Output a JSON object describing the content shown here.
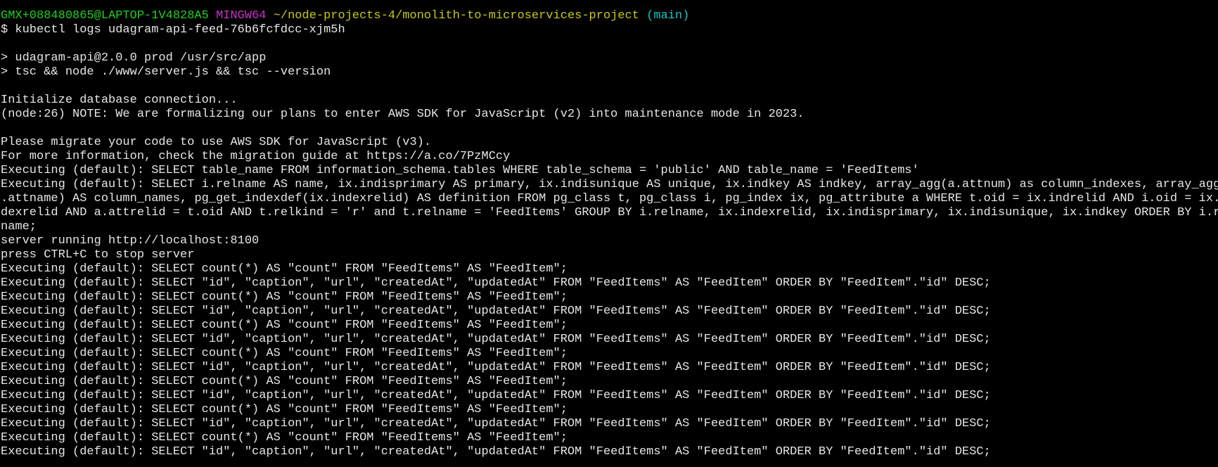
{
  "prompt": {
    "user_host": "GMX+088480865@LAPTOP-1V4828A5",
    "shell": "MINGW64",
    "path": "~/node-projects-4/monolith-to-microservices-project",
    "branch": "(main)"
  },
  "colors": {
    "user_host": "#1fd11f",
    "shell": "#c832c8",
    "path": "#c8c814",
    "branch": "#14c8c8",
    "text": "#e6e6e6",
    "background": "#000000"
  },
  "command": "$ kubectl logs udagram-api-feed-76b6fcfdcc-xjm5h",
  "output": [
    "",
    "> udagram-api@2.0.0 prod /usr/src/app",
    "> tsc && node ./www/server.js && tsc --version",
    "",
    "Initialize database connection...",
    "(node:26) NOTE: We are formalizing our plans to enter AWS SDK for JavaScript (v2) into maintenance mode in 2023.",
    "",
    "Please migrate your code to use AWS SDK for JavaScript (v3).",
    "For more information, check the migration guide at https://a.co/7PzMCcy",
    "Executing (default): SELECT table_name FROM information_schema.tables WHERE table_schema = 'public' AND table_name = 'FeedItems'",
    "Executing (default): SELECT i.relname AS name, ix.indisprimary AS primary, ix.indisunique AS unique, ix.indkey AS indkey, array_agg(a.attnum) as column_indexes, array_agg(a",
    ".attname) AS column_names, pg_get_indexdef(ix.indexrelid) AS definition FROM pg_class t, pg_class i, pg_index ix, pg_attribute a WHERE t.oid = ix.indrelid AND i.oid = ix.in",
    "dexrelid AND a.attrelid = t.oid AND t.relkind = 'r' and t.relname = 'FeedItems' GROUP BY i.relname, ix.indexrelid, ix.indisprimary, ix.indisunique, ix.indkey ORDER BY i.rel",
    "name;",
    "server running http://localhost:8100",
    "press CTRL+C to stop server",
    "Executing (default): SELECT count(*) AS \"count\" FROM \"FeedItems\" AS \"FeedItem\";",
    "Executing (default): SELECT \"id\", \"caption\", \"url\", \"createdAt\", \"updatedAt\" FROM \"FeedItems\" AS \"FeedItem\" ORDER BY \"FeedItem\".\"id\" DESC;",
    "Executing (default): SELECT count(*) AS \"count\" FROM \"FeedItems\" AS \"FeedItem\";",
    "Executing (default): SELECT \"id\", \"caption\", \"url\", \"createdAt\", \"updatedAt\" FROM \"FeedItems\" AS \"FeedItem\" ORDER BY \"FeedItem\".\"id\" DESC;",
    "Executing (default): SELECT count(*) AS \"count\" FROM \"FeedItems\" AS \"FeedItem\";",
    "Executing (default): SELECT \"id\", \"caption\", \"url\", \"createdAt\", \"updatedAt\" FROM \"FeedItems\" AS \"FeedItem\" ORDER BY \"FeedItem\".\"id\" DESC;",
    "Executing (default): SELECT count(*) AS \"count\" FROM \"FeedItems\" AS \"FeedItem\";",
    "Executing (default): SELECT \"id\", \"caption\", \"url\", \"createdAt\", \"updatedAt\" FROM \"FeedItems\" AS \"FeedItem\" ORDER BY \"FeedItem\".\"id\" DESC;",
    "Executing (default): SELECT count(*) AS \"count\" FROM \"FeedItems\" AS \"FeedItem\";",
    "Executing (default): SELECT \"id\", \"caption\", \"url\", \"createdAt\", \"updatedAt\" FROM \"FeedItems\" AS \"FeedItem\" ORDER BY \"FeedItem\".\"id\" DESC;",
    "Executing (default): SELECT count(*) AS \"count\" FROM \"FeedItems\" AS \"FeedItem\";",
    "Executing (default): SELECT \"id\", \"caption\", \"url\", \"createdAt\", \"updatedAt\" FROM \"FeedItems\" AS \"FeedItem\" ORDER BY \"FeedItem\".\"id\" DESC;",
    "Executing (default): SELECT count(*) AS \"count\" FROM \"FeedItems\" AS \"FeedItem\";",
    "Executing (default): SELECT \"id\", \"caption\", \"url\", \"createdAt\", \"updatedAt\" FROM \"FeedItems\" AS \"FeedItem\" ORDER BY \"FeedItem\".\"id\" DESC;"
  ]
}
